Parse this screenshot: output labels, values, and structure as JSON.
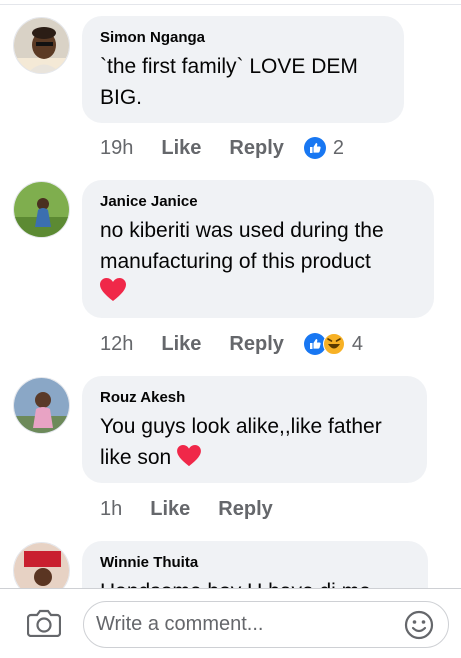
{
  "comments": [
    {
      "author": "Simon Nganga",
      "text_lines": [
        "`the first family` LOVE DEM",
        "BIG."
      ],
      "time": "19h",
      "like_label": "Like",
      "reply_label": "Reply",
      "reactions": [
        "like-icon"
      ],
      "reaction_count": "2"
    },
    {
      "author": "Janice Janice",
      "text_lines": [
        "no kiberiti was used during the",
        "manufacturing of this product"
      ],
      "emoji": "heart-icon",
      "time": "12h",
      "like_label": "Like",
      "reply_label": "Reply",
      "reactions": [
        "like-icon",
        "haha-icon"
      ],
      "reaction_count": "4"
    },
    {
      "author": "Rouz Akesh",
      "text_lines": [
        "You guys look alike,,like father",
        "like son"
      ],
      "emoji": "heart-icon",
      "time": "1h",
      "like_label": "Like",
      "reply_label": "Reply"
    },
    {
      "author": "Winnie Thuita",
      "text_lines": [
        "Handsome boy U have di me"
      ]
    }
  ],
  "composer": {
    "placeholder": "Write a comment...",
    "camera_icon": "camera-icon",
    "emoji_icon": "smiley-icon"
  },
  "colors": {
    "bubble": "#f0f2f5",
    "meta_text": "#65676b",
    "like_blue": "#1877f2",
    "heart_red": "#f02849"
  }
}
